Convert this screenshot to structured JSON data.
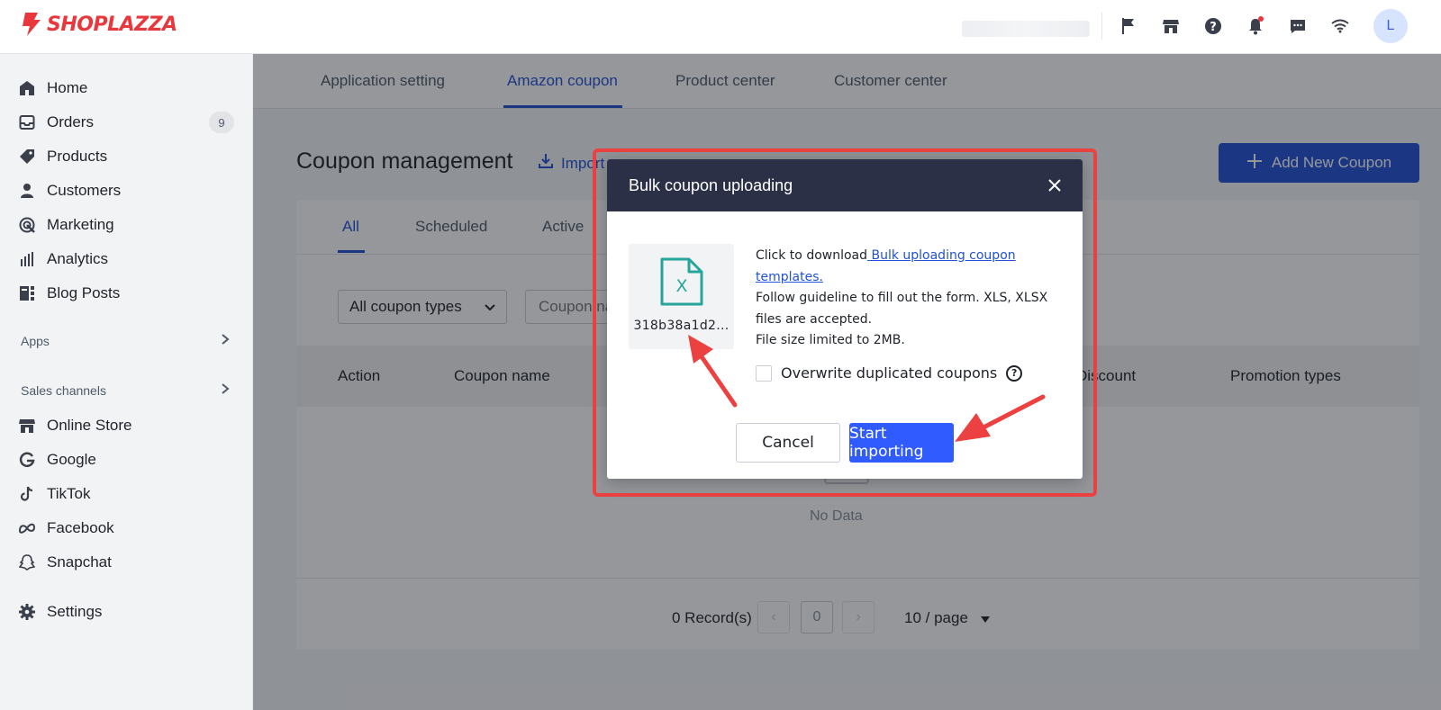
{
  "brand": {
    "name": "SHOPLAZZA",
    "color": "#e8383d"
  },
  "topbar": {
    "icons": [
      "flag-icon",
      "store-icon",
      "help-icon",
      "bell-icon",
      "chat-icon",
      "wifi-icon"
    ],
    "avatar_initial": "L"
  },
  "sidebar": {
    "items": [
      {
        "label": "Home",
        "icon": "home-icon"
      },
      {
        "label": "Orders",
        "icon": "inbox-icon",
        "badge": "9"
      },
      {
        "label": "Products",
        "icon": "tag-icon"
      },
      {
        "label": "Customers",
        "icon": "person-icon"
      },
      {
        "label": "Marketing",
        "icon": "target-icon"
      },
      {
        "label": "Analytics",
        "icon": "bar-chart-icon"
      },
      {
        "label": "Blog Posts",
        "icon": "blog-icon"
      }
    ],
    "apps_title": "Apps",
    "sales_title": "Sales channels",
    "channels": [
      {
        "label": "Online Store",
        "icon": "store-icon"
      },
      {
        "label": "Google",
        "icon": "google-icon"
      },
      {
        "label": "TikTok",
        "icon": "tiktok-icon"
      },
      {
        "label": "Facebook",
        "icon": "meta-icon"
      },
      {
        "label": "Snapchat",
        "icon": "ghost-icon"
      }
    ],
    "settings_label": "Settings"
  },
  "main": {
    "tabs": [
      "Application setting",
      "Amazon coupon",
      "Product center",
      "Customer center"
    ],
    "active_tab": "Amazon coupon",
    "page_title": "Coupon management",
    "import_label": "Import",
    "add_button": "Add New Coupon",
    "sub_tabs": [
      "All",
      "Scheduled",
      "Active"
    ],
    "filter_select": "All coupon types",
    "search_placeholder": "Coupon name",
    "columns": [
      "Action",
      "Coupon name",
      "Discount",
      "Promotion types"
    ],
    "no_data": "No Data",
    "records": "0 Record(s)",
    "page_number": "0",
    "per_page": "10 / page"
  },
  "modal": {
    "title": "Bulk coupon uploading",
    "file_letter": "X",
    "file_name": "318b38a1d2...",
    "text_prefix": "Click to download",
    "template_link": " Bulk uploading coupon templates.",
    "guideline": "Follow guideline to fill out the form. XLS, XLSX files are accepted.",
    "size_limit": "File size limited to 2MB.",
    "overwrite_label": "Overwrite duplicated coupons",
    "cancel_label": "Cancel",
    "start_label": "Start importing"
  },
  "colors": {
    "accent": "#2151d8",
    "modal_header": "#2b3047",
    "annotation": "#ec4141",
    "file_icon": "#26a69a"
  }
}
